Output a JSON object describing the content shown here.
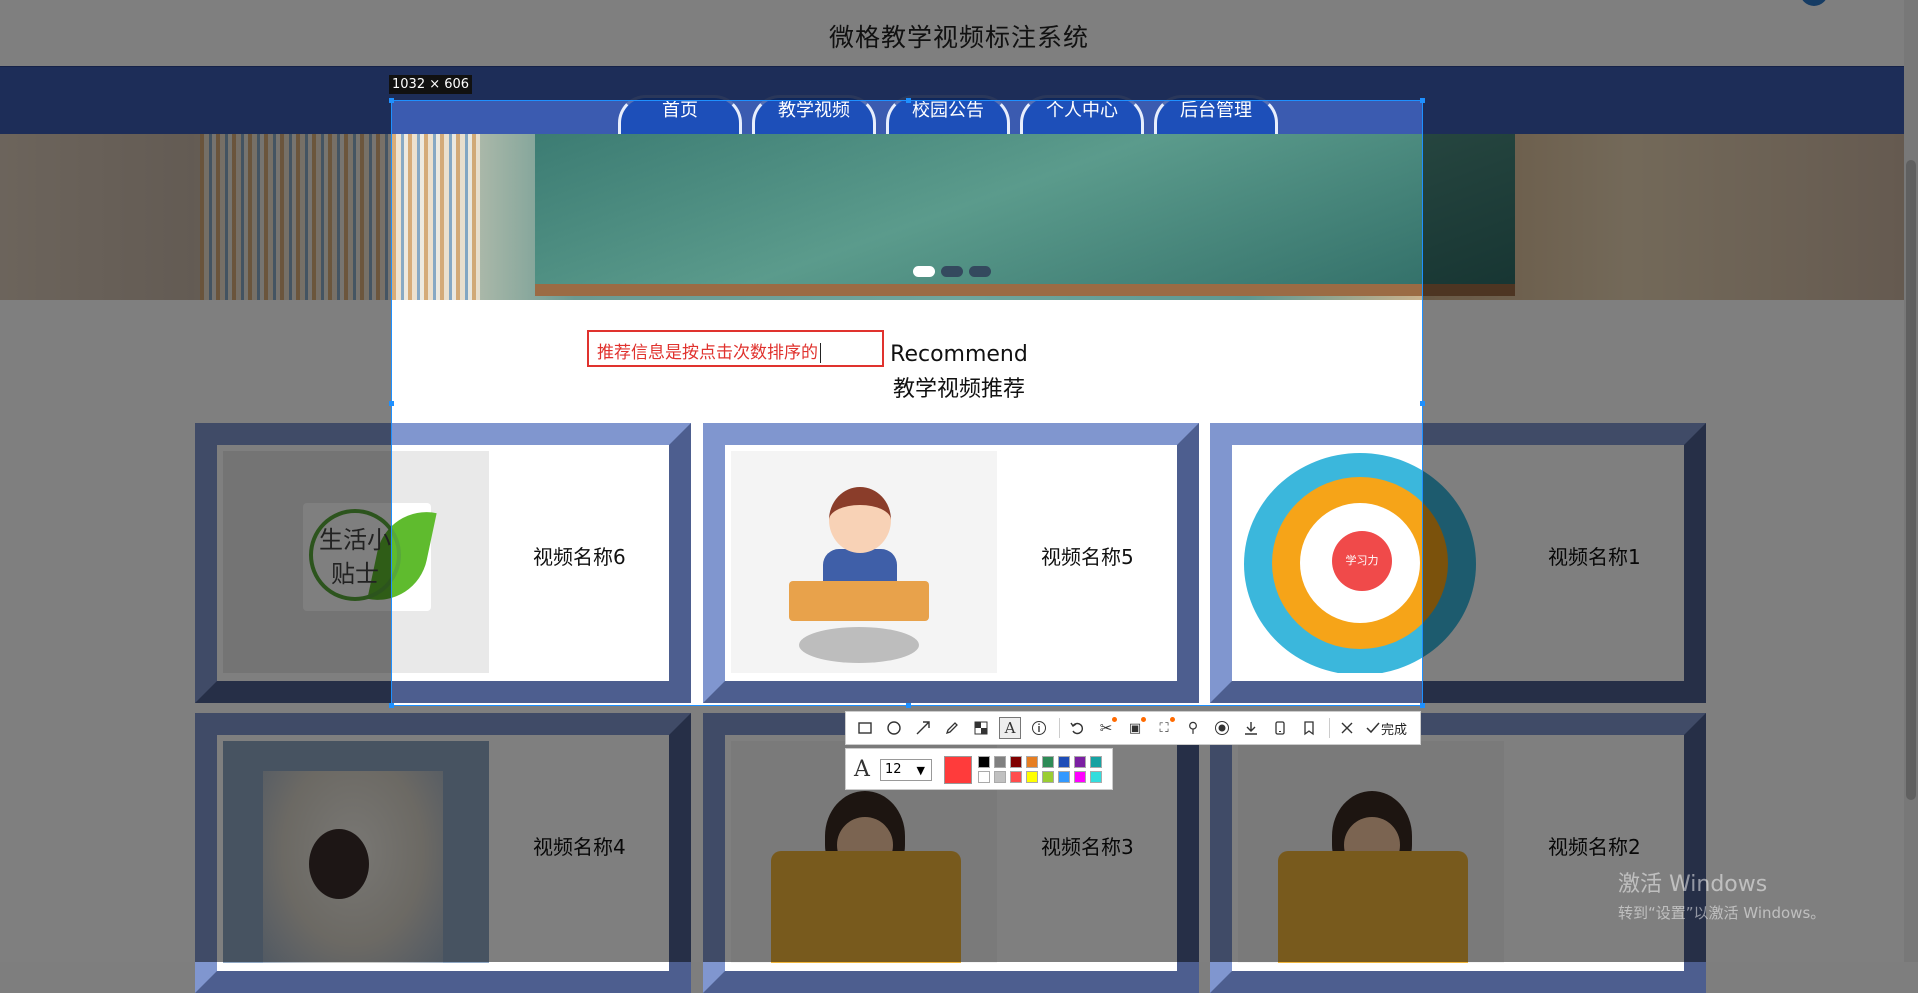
{
  "site": {
    "title": "微格教学视频标注系统"
  },
  "nav": {
    "tabs": [
      {
        "label": "首页"
      },
      {
        "label": "教学视频"
      },
      {
        "label": "校园公告"
      },
      {
        "label": "个人中心"
      },
      {
        "label": "后台管理"
      }
    ]
  },
  "section": {
    "title_en": "Recommend",
    "title_zh": "教学视频推荐"
  },
  "videos": [
    {
      "name": "视频名称6",
      "thumb_text": "生活小贴士"
    },
    {
      "name": "视频名称5"
    },
    {
      "name": "视频名称1",
      "thumb_center": "学习力"
    },
    {
      "name": "视频名称4"
    },
    {
      "name": "视频名称3"
    },
    {
      "name": "视频名称2"
    }
  ],
  "capture": {
    "size_label": "1032 × 606",
    "text_annotation": "推荐信息是按点击次数排序的",
    "font_size": "12",
    "current_color": "#ff3b3b",
    "done_label": "完成",
    "palette": [
      "#000000",
      "#808080",
      "#800000",
      "#e67e22",
      "#2e8b57",
      "#1e4db7",
      "#7b1fa2",
      "#17a2a2",
      "#ffffff",
      "#c0c0c0",
      "#ff4d4d",
      "#ffff00",
      "#9acd32",
      "#3399ff",
      "#ff00ff",
      "#33dddd"
    ]
  },
  "watermark": {
    "title": "激活 Windows",
    "subtitle": "转到“设置”以激活 Windows。"
  }
}
